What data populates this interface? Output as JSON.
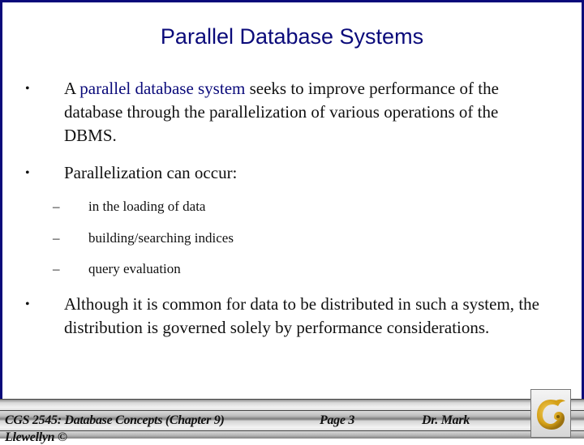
{
  "slide": {
    "title": "Parallel Database Systems",
    "bullets": [
      {
        "pre": "A ",
        "highlight": "parallel database system",
        "post": " seeks to improve performance of the database through the parallelization of various operations of the DBMS."
      },
      {
        "text": "Parallelization can occur:",
        "sub_items": [
          "in the loading of data",
          "building/searching indices",
          "query evaluation"
        ]
      },
      {
        "text": "Although it is common for data to be distributed in such a system, the distribution is governed solely by performance considerations."
      }
    ],
    "bullet_glyph": "•",
    "sub_glyph": "–"
  },
  "footer": {
    "course": "CGS 2545: Database Concepts  (Chapter 9)",
    "page": "Page 3",
    "author": "Dr. Mark",
    "author_cont": "Llewellyn ©",
    "logo": "ucf-pegasus-logo"
  },
  "colors": {
    "frame": "#0a0a7a",
    "title": "#0a0a7a",
    "highlight": "#0a0a7a",
    "logo_gold": "#d4a017"
  }
}
